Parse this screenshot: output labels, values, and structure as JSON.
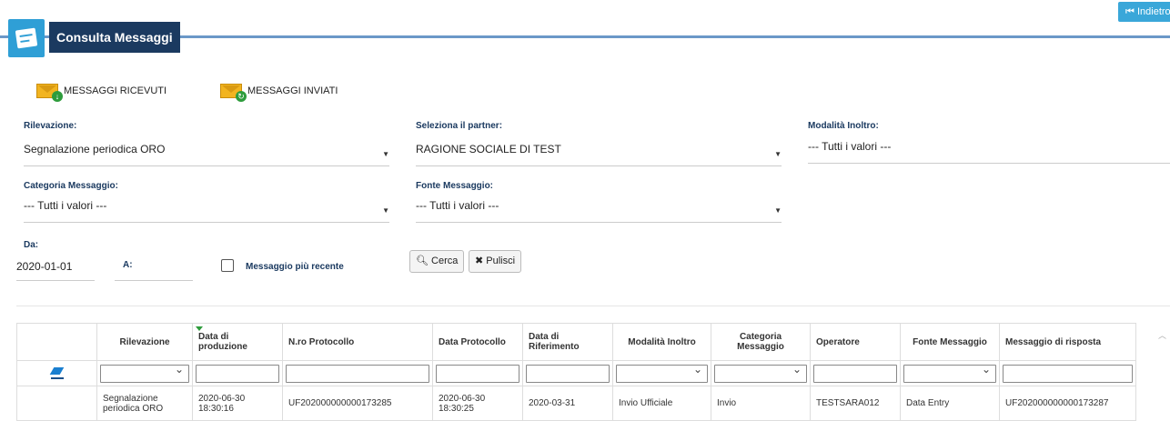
{
  "header": {
    "title": "Consulta Messaggi",
    "back_label": "Indietro"
  },
  "tabs": [
    {
      "label": "MESSAGGI RICEVUTI"
    },
    {
      "label": "MESSAGGI INVIATI"
    }
  ],
  "filters": {
    "rilevazione": {
      "label": "Rilevazione:",
      "value": "Segnalazione periodica ORO"
    },
    "partner": {
      "label": "Seleziona il partner:",
      "value": "RAGIONE SOCIALE DI TEST"
    },
    "modalita": {
      "label": "Modalità Inoltro:",
      "value": "--- Tutti i valori ---"
    },
    "categoria": {
      "label": "Categoria Messaggio:",
      "value": "--- Tutti i valori ---"
    },
    "fonte": {
      "label": "Fonte Messaggio:",
      "value": "--- Tutti i valori ---"
    },
    "da": {
      "label": "Da:",
      "value": "2020-01-01"
    },
    "a": {
      "label": "A:",
      "value": ""
    },
    "recente": {
      "label": "Messaggio più recente"
    },
    "cerca_label": "Cerca",
    "pulisci_label": "Pulisci"
  },
  "table": {
    "columns": [
      "Rilevazione",
      "Data di produzione",
      "N.ro Protocollo",
      "Data Protocollo",
      "Data di Riferimento",
      "Modalità Inoltro",
      "Categoria Messaggio",
      "Operatore",
      "Fonte Messaggio",
      "Messaggio di risposta"
    ],
    "rows": [
      {
        "rilevazione": "Segnalazione periodica ORO",
        "data_produzione": "2020-06-30 18:30:16",
        "protocollo": "UF202000000000173285",
        "data_protocollo": "2020-06-30 18:30:25",
        "data_riferimento": "2020-03-31",
        "modalita": "Invio Ufficiale",
        "categoria": "Invio",
        "operatore": "TESTSARA012",
        "fonte": "Data Entry",
        "risposta": "UF202000000000173287"
      }
    ]
  }
}
